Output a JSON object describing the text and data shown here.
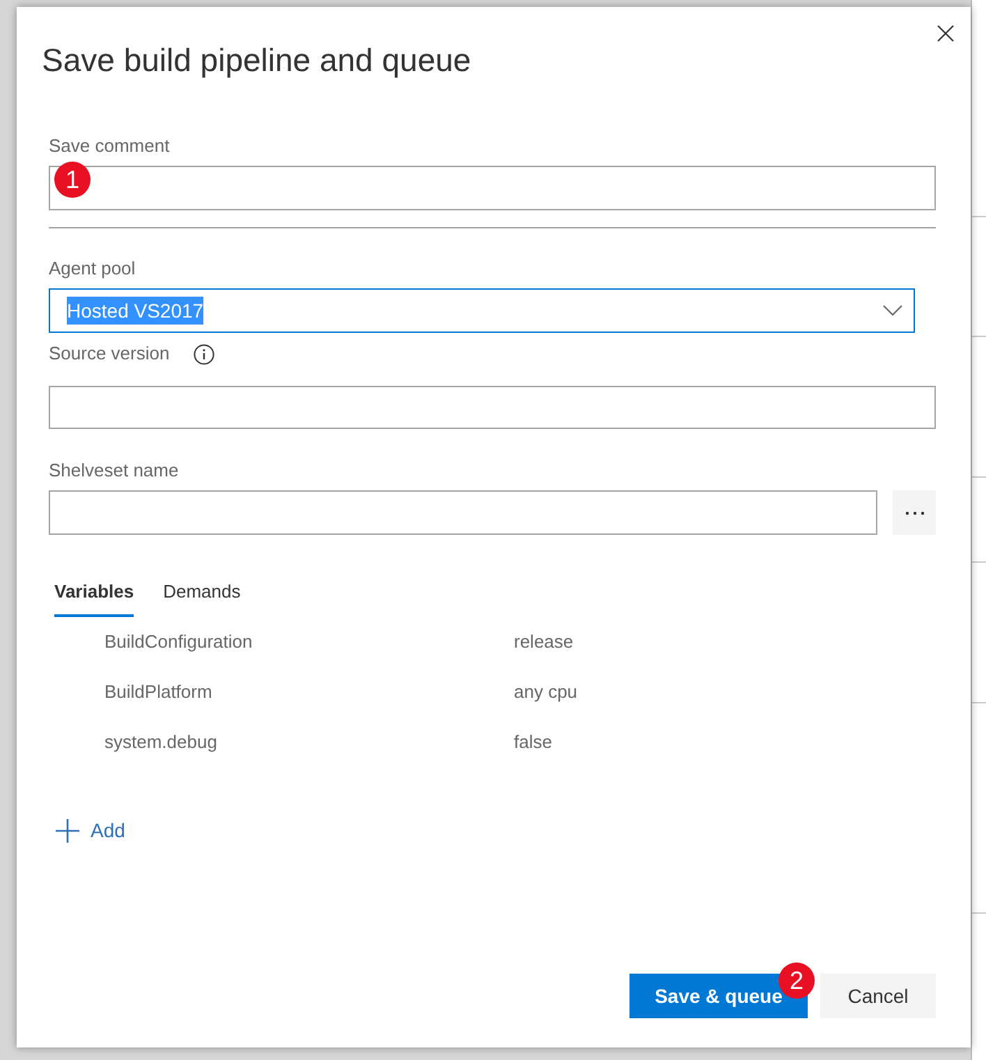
{
  "dialog": {
    "title": "Save build pipeline and queue"
  },
  "save_comment": {
    "label": "Save comment",
    "marker": "1"
  },
  "agent_pool": {
    "label": "Agent pool",
    "value": "Hosted VS2017",
    "focused": true
  },
  "source_version": {
    "label": "Source version"
  },
  "shelveset_name": {
    "label": "Shelveset name"
  },
  "tabs": [
    {
      "label": "Variables",
      "selected": true
    },
    {
      "label": "Demands",
      "selected": false
    }
  ],
  "variables": [
    {
      "name": "BuildConfiguration",
      "value": "release"
    },
    {
      "name": "BuildPlatform",
      "value": "any cpu"
    },
    {
      "name": "system.debug",
      "value": "false"
    }
  ],
  "add_link": {
    "label": "Add"
  },
  "buttons": [
    {
      "label": "Save & queue",
      "kind": "primary",
      "marker": "2"
    },
    {
      "label": "Cancel",
      "kind": "secondary"
    }
  ]
}
